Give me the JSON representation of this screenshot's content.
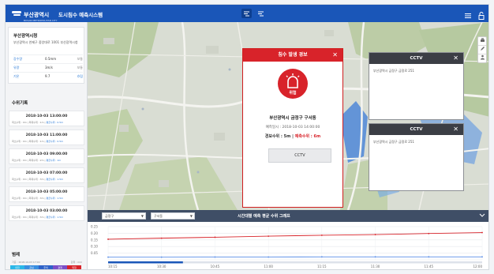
{
  "header": {
    "logo_text": "부산광역시",
    "logo_sub": "BUSAN METROPOLITAN CITY",
    "title": "도시침수 예측시스템",
    "view_toggle_1_icon": "map-view-icon",
    "view_toggle_2_icon": "list-view-icon",
    "menu_icon": "hamburger-menu-icon",
    "lock_icon": "lock-icon"
  },
  "info_card": {
    "name": "부산광역시청",
    "address": "부산광역시 연제구 중앙대로 1001 부산광역시청",
    "rows": [
      {
        "key": "강수량",
        "value": "0.5mm",
        "status": "보통"
      },
      {
        "key": "유량",
        "value": "3m/s",
        "status": "보통"
      },
      {
        "key": "기온",
        "value": "9.7",
        "status": "흐림"
      }
    ]
  },
  "records": {
    "title": "수위기록",
    "items": [
      {
        "time": "2018-10-03 13:00:00",
        "detail": "최소수위 : 0m | 최대수위 : 1m |",
        "status": "평균수위 : 0.5m"
      },
      {
        "time": "2018-10-03 11:00:00",
        "detail": "최소수위 : 0m | 최대수위 : 1m |",
        "status": "평균수위 : 0.5m"
      },
      {
        "time": "2018-10-03 09:00:00",
        "detail": "최소수위 : 0m | 최대수위 : 2m |",
        "status": "평균수위 : 1m"
      },
      {
        "time": "2018-10-03 07:00:00",
        "detail": "최소수위 : 0m | 최대수위 : 3m |",
        "status": "평균수위 : 1.5m"
      },
      {
        "time": "2018-10-03 05:00:00",
        "detail": "최소수위 : 0m | 최대수위 : 3m |",
        "status": "평균수위 : 1.5m"
      },
      {
        "time": "2018-10-03 03:00:00",
        "detail": "최소수위 : 0m | 최대수위 : 3m |",
        "status": "평균수위 : 1.5m"
      }
    ]
  },
  "legend": {
    "title": "범례",
    "note": "기준 : 2018-10-03 17:00",
    "unit": "단위 : mm",
    "items": [
      {
        "label": "안전",
        "color": "#2ab7e8"
      },
      {
        "label": "관심",
        "color": "#3a8ee0"
      },
      {
        "label": "주의",
        "color": "#2e62c8"
      },
      {
        "label": "경계",
        "color": "#7a4fc8"
      },
      {
        "label": "위험",
        "color": "#d8232a"
      }
    ]
  },
  "alert": {
    "title": "침수 발생 경보",
    "level": "위험",
    "location": "부산광역시 금정구 구서동",
    "predict_time": "예측일시 : 2018-10-03 14:00:00",
    "warning_level": "경보수위 : 5m",
    "predict_level": "예측수위 : 6m",
    "cctv_button": "CCTV"
  },
  "cctv_windows": [
    {
      "title": "CCTV",
      "address": "부산광역시 금정구 금정로 251"
    },
    {
      "title": "CCTV",
      "address": "부산광역시 금정구 금정로 251"
    }
  ],
  "map_tools": [
    "print-icon",
    "edit-icon",
    "person-icon"
  ],
  "bottom": {
    "district_select": "금정구",
    "dong_select": "구서동",
    "chart_title": "시간대별 예측 평균 수위 그래프",
    "collapse_icon": "chevron-down-icon"
  },
  "chart_data": {
    "type": "line",
    "x": [
      "10:15",
      "10:30",
      "10:45",
      "11:00",
      "11:15",
      "11:30",
      "11:45",
      "12:00"
    ],
    "ytick_labels": [
      "0.25",
      "0.20",
      "0.15",
      "0.10",
      "0.05",
      ""
    ],
    "ylim": [
      0,
      0.25
    ],
    "series": [
      {
        "color": "#d8232a",
        "values": [
          0.155,
          0.163,
          0.17,
          0.178,
          0.185,
          0.19,
          0.198,
          0.205
        ]
      },
      {
        "color": "#5a8ee8",
        "values": [
          0.02,
          0.02,
          0.021,
          0.021,
          0.022,
          0.022,
          0.022,
          0.022
        ]
      }
    ],
    "progress": 0.2
  }
}
